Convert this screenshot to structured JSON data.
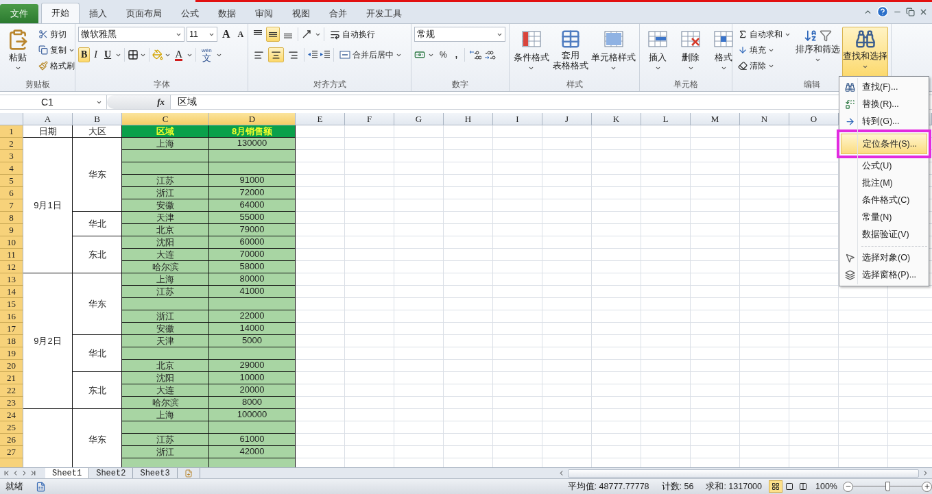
{
  "ribbon_tabs": [
    {
      "label": "文件",
      "kind": "file",
      "selected": false
    },
    {
      "label": "开始",
      "kind": "tab",
      "selected": true
    },
    {
      "label": "插入",
      "kind": "tab",
      "selected": false
    },
    {
      "label": "页面布局",
      "kind": "tab",
      "selected": false
    },
    {
      "label": "公式",
      "kind": "tab",
      "selected": false
    },
    {
      "label": "数据",
      "kind": "tab",
      "selected": false
    },
    {
      "label": "审阅",
      "kind": "tab",
      "selected": false
    },
    {
      "label": "视图",
      "kind": "tab",
      "selected": false
    },
    {
      "label": "合并",
      "kind": "tab",
      "selected": false
    },
    {
      "label": "开发工具",
      "kind": "tab",
      "selected": false
    }
  ],
  "clipboard": {
    "label": "剪贴板",
    "paste": "粘贴",
    "cut": "剪切",
    "copy": "复制",
    "format_painter": "格式刷"
  },
  "font": {
    "label": "字体",
    "font_name": "微软雅黑",
    "font_size": "11",
    "grow": "A",
    "shrink": "A",
    "bold": {
      "label": "B",
      "on": true
    },
    "italic": "I",
    "underline": "U",
    "font_color": "A",
    "phonetic": "文",
    "phonetic_hint": "wén"
  },
  "alignment": {
    "label": "对齐方式",
    "wrap_text": "自动换行",
    "merge_center": "合并后居中",
    "vertical": [
      {
        "on": false
      },
      {
        "on": true
      },
      {
        "on": false
      }
    ],
    "horizontal": [
      {
        "on": false
      },
      {
        "on": true
      },
      {
        "on": false
      }
    ]
  },
  "number": {
    "label": "数字",
    "format": "常规",
    "percent": "%",
    "comma": ","
  },
  "styles": {
    "label": "样式",
    "conditional": "条件格式",
    "table_format_1": "套用",
    "table_format_2": "表格格式",
    "cell_styles": "单元格样式"
  },
  "cells": {
    "label": "单元格",
    "insert": "插入",
    "delete": "删除",
    "format": "格式"
  },
  "editing": {
    "label": "编辑",
    "autosum": "自动求和",
    "fill": "填充",
    "clear": "清除",
    "sort_filter": "排序和筛选",
    "find_select": {
      "label": "查找和选择",
      "on": true
    }
  },
  "formula_bar": {
    "name_box": "C1",
    "fx": "fx",
    "content": "区域"
  },
  "columns": [
    {
      "label": "A",
      "selected": false
    },
    {
      "label": "B",
      "selected": false
    },
    {
      "label": "C",
      "selected": true
    },
    {
      "label": "D",
      "selected": true
    },
    {
      "label": "E",
      "selected": false
    },
    {
      "label": "F",
      "selected": false
    },
    {
      "label": "G",
      "selected": false
    },
    {
      "label": "H",
      "selected": false
    },
    {
      "label": "I",
      "selected": false
    },
    {
      "label": "J",
      "selected": false
    },
    {
      "label": "K",
      "selected": false
    },
    {
      "label": "L",
      "selected": false
    },
    {
      "label": "M",
      "selected": false
    },
    {
      "label": "N",
      "selected": false
    },
    {
      "label": "O",
      "selected": false
    }
  ],
  "header_row": {
    "number": "1",
    "selected": true,
    "date": "日期",
    "area": "大区",
    "region": "区域",
    "amount": "8月销售额"
  },
  "groups": [
    {
      "date": "9月1日",
      "regions": [
        {
          "name": "华东",
          "rows": [
            {
              "number": "2",
              "selected": true,
              "region": "上海",
              "amount": "130000"
            },
            {
              "number": "3",
              "selected": true
            },
            {
              "number": "4",
              "selected": true
            },
            {
              "number": "5",
              "selected": true,
              "region": "江苏",
              "amount": "91000"
            },
            {
              "number": "6",
              "selected": true,
              "region": "浙江",
              "amount": "72000"
            },
            {
              "number": "7",
              "selected": true,
              "region": "安徽",
              "amount": "64000"
            }
          ]
        },
        {
          "name": "华北",
          "rows": [
            {
              "number": "8",
              "selected": true,
              "region": "天津",
              "amount": "55000"
            },
            {
              "number": "9",
              "selected": true,
              "region": "北京",
              "amount": "79000"
            }
          ]
        },
        {
          "name": "东北",
          "rows": [
            {
              "number": "10",
              "selected": true,
              "region": "沈阳",
              "amount": "60000"
            },
            {
              "number": "11",
              "selected": true,
              "region": "大连",
              "amount": "70000"
            },
            {
              "number": "12",
              "selected": true,
              "region": "哈尔滨",
              "amount": "58000"
            }
          ]
        }
      ]
    },
    {
      "date": "9月2日",
      "regions": [
        {
          "name": "华东",
          "rows": [
            {
              "number": "13",
              "selected": true,
              "region": "上海",
              "amount": "80000"
            },
            {
              "number": "14",
              "selected": true,
              "region": "江苏",
              "amount": "41000"
            },
            {
              "number": "15",
              "selected": true
            },
            {
              "number": "16",
              "selected": true,
              "region": "浙江",
              "amount": "22000"
            },
            {
              "number": "17",
              "selected": true,
              "region": "安徽",
              "amount": "14000"
            }
          ]
        },
        {
          "name": "华北",
          "rows": [
            {
              "number": "18",
              "selected": true,
              "region": "天津",
              "amount": "5000"
            },
            {
              "number": "19",
              "selected": true
            },
            {
              "number": "20",
              "selected": true,
              "region": "北京",
              "amount": "29000"
            }
          ]
        },
        {
          "name": "东北",
          "rows": [
            {
              "number": "21",
              "selected": true,
              "region": "沈阳",
              "amount": "10000"
            },
            {
              "number": "22",
              "selected": true,
              "region": "大连",
              "amount": "20000"
            },
            {
              "number": "23",
              "selected": true,
              "region": "哈尔滨",
              "amount": "8000"
            }
          ]
        }
      ]
    },
    {
      "regions": [
        {
          "name": "华东",
          "rows": [
            {
              "number": "24",
              "selected": true,
              "region": "上海",
              "amount": "100000"
            },
            {
              "number": "25",
              "selected": true
            },
            {
              "number": "26",
              "selected": true,
              "region": "江苏",
              "amount": "61000"
            },
            {
              "number": "27",
              "selected": true,
              "region": "浙江",
              "amount": "42000"
            }
          ]
        }
      ]
    }
  ],
  "find_menu": {
    "items": [
      {
        "label": "查找(F)...",
        "kind": "find",
        "selected": false
      },
      {
        "label": "替换(R)...",
        "kind": "replace",
        "selected": false
      },
      {
        "label": "转到(G)...",
        "kind": "goto",
        "selected": false
      },
      {
        "label": "定位条件(S)...",
        "kind": "plain",
        "selected": true
      },
      {
        "label": "公式(U)",
        "kind": "plain",
        "selected": false
      },
      {
        "label": "批注(M)",
        "kind": "plain",
        "selected": false
      },
      {
        "label": "条件格式(C)",
        "kind": "plain",
        "selected": false
      },
      {
        "label": "常量(N)",
        "kind": "plain",
        "selected": false
      },
      {
        "label": "数据验证(V)",
        "kind": "plain",
        "selected": false
      },
      {
        "label": "选择对象(O)",
        "kind": "objects",
        "selected": false
      },
      {
        "label": "选择窗格(P)...",
        "kind": "pane",
        "selected": false
      }
    ]
  },
  "sheet_tabs": [
    {
      "label": "Sheet1",
      "selected": true
    },
    {
      "label": "Sheet2",
      "selected": false
    },
    {
      "label": "Sheet3",
      "selected": false
    }
  ],
  "status_bar": {
    "ready": "就绪",
    "average": "平均值: 48777.77778",
    "count": "计数: 56",
    "sum": "求和: 1317000",
    "views": [
      {
        "selected": true
      },
      {
        "selected": false
      },
      {
        "selected": false
      }
    ],
    "zoom": "100%",
    "zoom_slider": {
      "level": 0.5
    }
  }
}
